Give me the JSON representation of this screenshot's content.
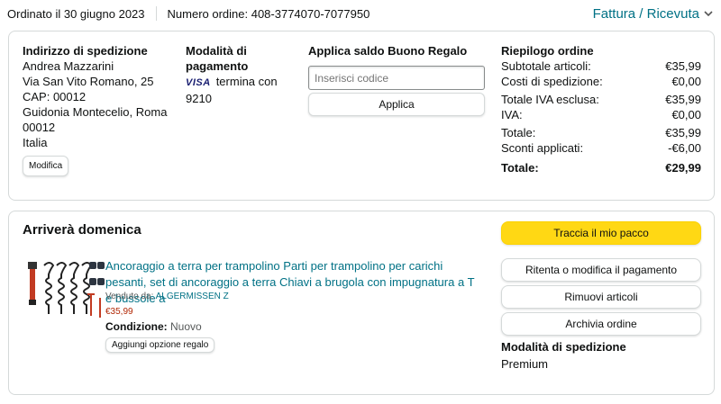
{
  "header": {
    "order_date": "Ordinato il 30 giugno 2023",
    "order_number": "Numero ordine: 408-3774070-7077950",
    "invoice_link": "Fattura / Ricevuta"
  },
  "shipping_address": {
    "title": "Indirizzo di spedizione",
    "lines": [
      "Andrea Mazzarini",
      "Via San Vito Romano, 25",
      "CAP: 00012",
      "Guidonia Montecelio, Roma",
      "00012",
      "Italia"
    ],
    "edit_label": "Modifica"
  },
  "payment": {
    "title": "Modalità di pagamento",
    "card_brand": "VISA",
    "card_text": "termina con 9210"
  },
  "gift_card": {
    "title": "Applica saldo Buono Regalo",
    "placeholder": "Inserisci codice",
    "apply_label": "Applica"
  },
  "summary": {
    "title": "Riepilogo ordine",
    "rows": [
      {
        "label": "Subtotale articoli:",
        "value": "€35,99"
      },
      {
        "label": "Costi di spedizione:",
        "value": "€0,00"
      },
      {
        "label": "Totale IVA esclusa:",
        "value": "€35,99"
      },
      {
        "label": "IVA:",
        "value": "€0,00"
      },
      {
        "label": "Totale:",
        "value": "€35,99"
      },
      {
        "label": "Sconti applicati:",
        "value": "-€6,00"
      }
    ],
    "total_label": "Totale:",
    "total_value": "€29,99"
  },
  "shipment": {
    "arrival": "Arriverà domenica",
    "product_title": "Ancoraggio a terra per trampolino Parti per trampolino per carichi pesanti, set di ancoraggio a terra Chiavi a brugola con impugnatura a T e bussole a",
    "sold_by_label": "Venduto da:",
    "seller": "ALGERMISSEN Z",
    "price": "€35,99",
    "condition_label": "Condizione:",
    "condition_value": "Nuovo",
    "gift_option_label": "Aggiungi opzione regalo",
    "actions": {
      "track": "Traccia il mio pacco",
      "retry_payment": "Ritenta o modifica il pagamento",
      "remove_items": "Rimuovi articoli",
      "archive": "Archivia ordine"
    },
    "shipping_method_title": "Modalità di spedizione",
    "shipping_method_value": "Premium"
  },
  "colors": {
    "link": "#007185",
    "primary_button": "#ffd814",
    "price": "#b12704",
    "border": "#d5d9d9"
  }
}
